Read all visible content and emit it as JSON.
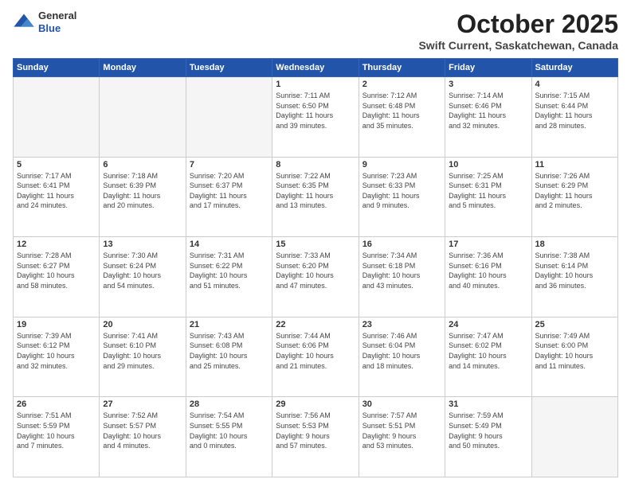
{
  "header": {
    "logo_general": "General",
    "logo_blue": "Blue",
    "month": "October 2025",
    "location": "Swift Current, Saskatchewan, Canada"
  },
  "weekdays": [
    "Sunday",
    "Monday",
    "Tuesday",
    "Wednesday",
    "Thursday",
    "Friday",
    "Saturday"
  ],
  "weeks": [
    [
      {
        "day": "",
        "info": ""
      },
      {
        "day": "",
        "info": ""
      },
      {
        "day": "",
        "info": ""
      },
      {
        "day": "1",
        "info": "Sunrise: 7:11 AM\nSunset: 6:50 PM\nDaylight: 11 hours\nand 39 minutes."
      },
      {
        "day": "2",
        "info": "Sunrise: 7:12 AM\nSunset: 6:48 PM\nDaylight: 11 hours\nand 35 minutes."
      },
      {
        "day": "3",
        "info": "Sunrise: 7:14 AM\nSunset: 6:46 PM\nDaylight: 11 hours\nand 32 minutes."
      },
      {
        "day": "4",
        "info": "Sunrise: 7:15 AM\nSunset: 6:44 PM\nDaylight: 11 hours\nand 28 minutes."
      }
    ],
    [
      {
        "day": "5",
        "info": "Sunrise: 7:17 AM\nSunset: 6:41 PM\nDaylight: 11 hours\nand 24 minutes."
      },
      {
        "day": "6",
        "info": "Sunrise: 7:18 AM\nSunset: 6:39 PM\nDaylight: 11 hours\nand 20 minutes."
      },
      {
        "day": "7",
        "info": "Sunrise: 7:20 AM\nSunset: 6:37 PM\nDaylight: 11 hours\nand 17 minutes."
      },
      {
        "day": "8",
        "info": "Sunrise: 7:22 AM\nSunset: 6:35 PM\nDaylight: 11 hours\nand 13 minutes."
      },
      {
        "day": "9",
        "info": "Sunrise: 7:23 AM\nSunset: 6:33 PM\nDaylight: 11 hours\nand 9 minutes."
      },
      {
        "day": "10",
        "info": "Sunrise: 7:25 AM\nSunset: 6:31 PM\nDaylight: 11 hours\nand 5 minutes."
      },
      {
        "day": "11",
        "info": "Sunrise: 7:26 AM\nSunset: 6:29 PM\nDaylight: 11 hours\nand 2 minutes."
      }
    ],
    [
      {
        "day": "12",
        "info": "Sunrise: 7:28 AM\nSunset: 6:27 PM\nDaylight: 10 hours\nand 58 minutes."
      },
      {
        "day": "13",
        "info": "Sunrise: 7:30 AM\nSunset: 6:24 PM\nDaylight: 10 hours\nand 54 minutes."
      },
      {
        "day": "14",
        "info": "Sunrise: 7:31 AM\nSunset: 6:22 PM\nDaylight: 10 hours\nand 51 minutes."
      },
      {
        "day": "15",
        "info": "Sunrise: 7:33 AM\nSunset: 6:20 PM\nDaylight: 10 hours\nand 47 minutes."
      },
      {
        "day": "16",
        "info": "Sunrise: 7:34 AM\nSunset: 6:18 PM\nDaylight: 10 hours\nand 43 minutes."
      },
      {
        "day": "17",
        "info": "Sunrise: 7:36 AM\nSunset: 6:16 PM\nDaylight: 10 hours\nand 40 minutes."
      },
      {
        "day": "18",
        "info": "Sunrise: 7:38 AM\nSunset: 6:14 PM\nDaylight: 10 hours\nand 36 minutes."
      }
    ],
    [
      {
        "day": "19",
        "info": "Sunrise: 7:39 AM\nSunset: 6:12 PM\nDaylight: 10 hours\nand 32 minutes."
      },
      {
        "day": "20",
        "info": "Sunrise: 7:41 AM\nSunset: 6:10 PM\nDaylight: 10 hours\nand 29 minutes."
      },
      {
        "day": "21",
        "info": "Sunrise: 7:43 AM\nSunset: 6:08 PM\nDaylight: 10 hours\nand 25 minutes."
      },
      {
        "day": "22",
        "info": "Sunrise: 7:44 AM\nSunset: 6:06 PM\nDaylight: 10 hours\nand 21 minutes."
      },
      {
        "day": "23",
        "info": "Sunrise: 7:46 AM\nSunset: 6:04 PM\nDaylight: 10 hours\nand 18 minutes."
      },
      {
        "day": "24",
        "info": "Sunrise: 7:47 AM\nSunset: 6:02 PM\nDaylight: 10 hours\nand 14 minutes."
      },
      {
        "day": "25",
        "info": "Sunrise: 7:49 AM\nSunset: 6:00 PM\nDaylight: 10 hours\nand 11 minutes."
      }
    ],
    [
      {
        "day": "26",
        "info": "Sunrise: 7:51 AM\nSunset: 5:59 PM\nDaylight: 10 hours\nand 7 minutes."
      },
      {
        "day": "27",
        "info": "Sunrise: 7:52 AM\nSunset: 5:57 PM\nDaylight: 10 hours\nand 4 minutes."
      },
      {
        "day": "28",
        "info": "Sunrise: 7:54 AM\nSunset: 5:55 PM\nDaylight: 10 hours\nand 0 minutes."
      },
      {
        "day": "29",
        "info": "Sunrise: 7:56 AM\nSunset: 5:53 PM\nDaylight: 9 hours\nand 57 minutes."
      },
      {
        "day": "30",
        "info": "Sunrise: 7:57 AM\nSunset: 5:51 PM\nDaylight: 9 hours\nand 53 minutes."
      },
      {
        "day": "31",
        "info": "Sunrise: 7:59 AM\nSunset: 5:49 PM\nDaylight: 9 hours\nand 50 minutes."
      },
      {
        "day": "",
        "info": ""
      }
    ]
  ]
}
